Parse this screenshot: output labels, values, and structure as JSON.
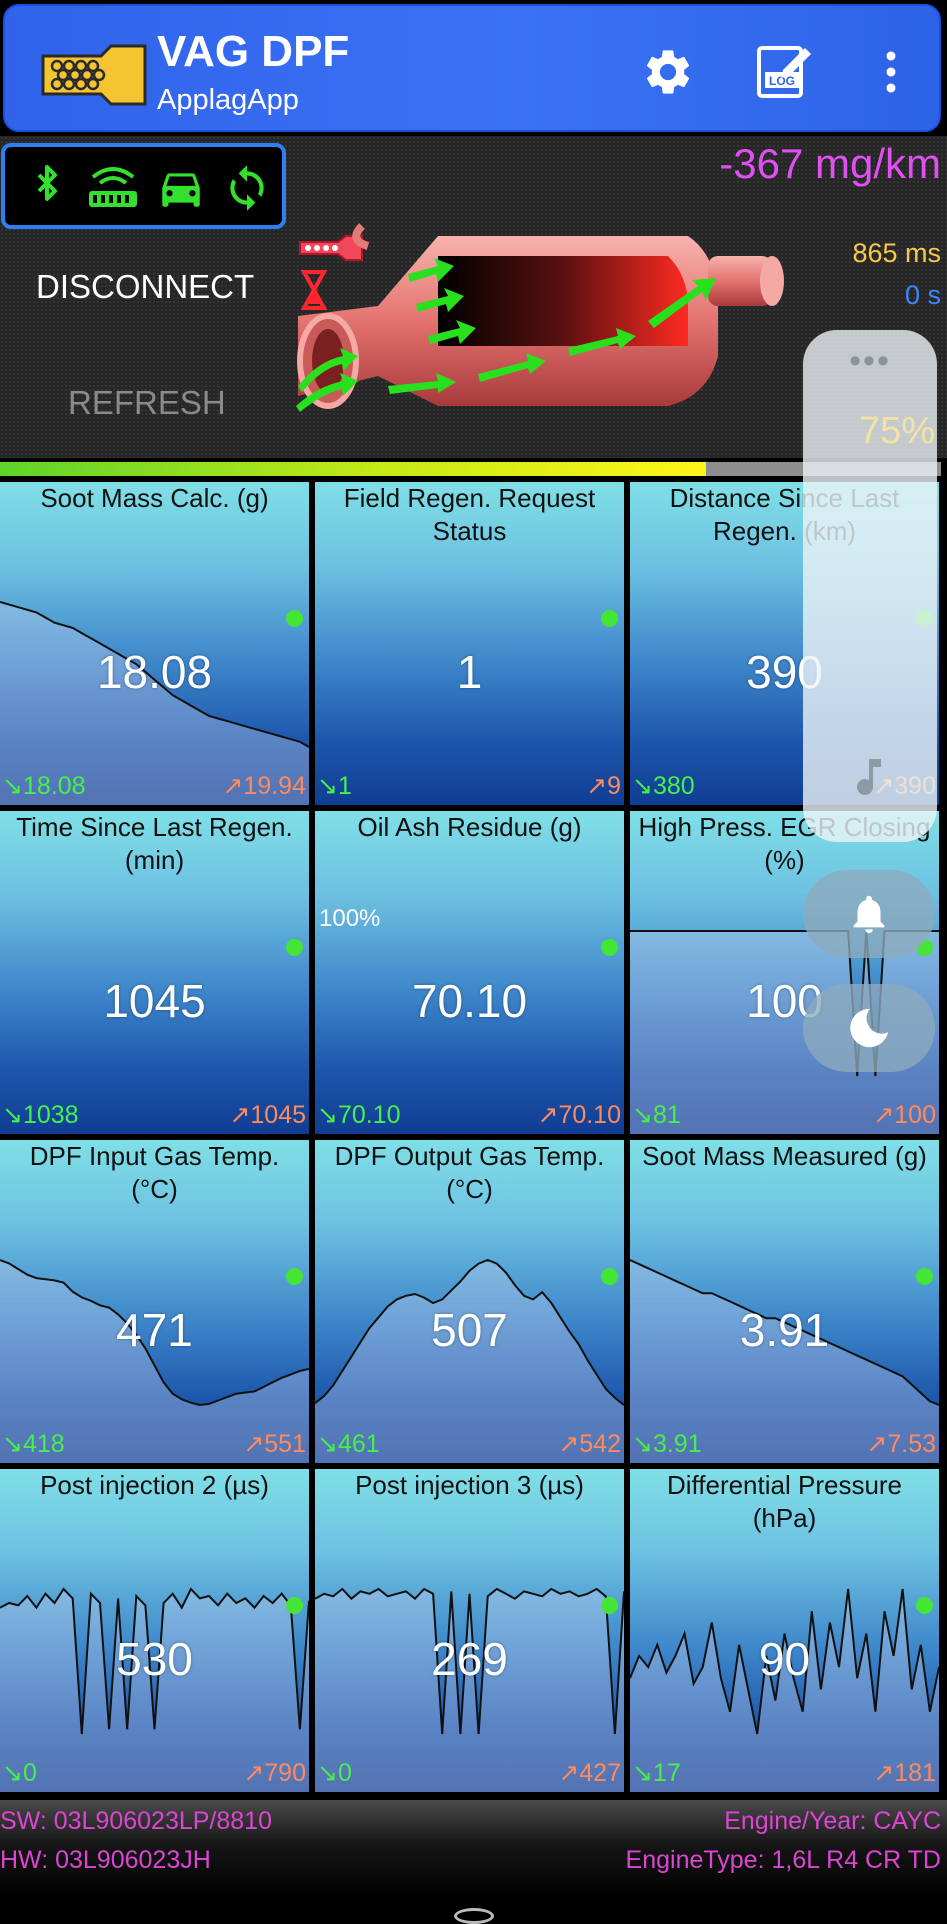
{
  "app": {
    "title": "VAG DPF",
    "subtitle": "ApplagApp",
    "accent": "#2f63ea",
    "actions": [
      {
        "name": "settings",
        "icon": "gear-icon"
      },
      {
        "name": "log",
        "icon": "log-icon"
      },
      {
        "name": "more",
        "icon": "overflow-menu-icon"
      }
    ]
  },
  "header": {
    "connection_icons": [
      "bluetooth-icon",
      "obd-adapter-icon",
      "car-icon",
      "sync-icon"
    ],
    "disconnect_label": "DISCONNECT",
    "refresh_label": "REFRESH",
    "consumption": "-367 mg/km",
    "latency": "865 ms",
    "timer": "0 s",
    "status_icons": [
      "dpf-icon",
      "hourglass-icon"
    ]
  },
  "progress": {
    "value": 0.75
  },
  "tiles": [
    {
      "title": "Soot Mass Calc. (g)",
      "value": "18.08",
      "min": "↘18.08",
      "max": "↗19.94",
      "series": [
        80,
        79,
        78,
        77,
        76,
        74,
        72,
        71,
        70,
        68,
        66,
        64,
        62,
        60,
        58,
        56,
        53,
        50,
        47,
        44,
        42,
        40,
        38,
        36,
        35,
        34,
        33,
        32,
        31,
        30,
        29,
        28,
        27,
        26,
        24
      ]
    },
    {
      "title": "Field Regen. Request Status",
      "value": "1",
      "min": "↘1",
      "max": "↗9"
    },
    {
      "title": "Distance Since Last Regen. (km)",
      "value": "390",
      "min": "↘380",
      "max": "↗390"
    },
    {
      "title": "Time Since Last Regen. (min)",
      "value": "1045",
      "min": "↘1038",
      "max": "↗1045"
    },
    {
      "title": "Oil Ash Residue (g)",
      "value": "70.10",
      "min": "↘70.10",
      "max": "↗70.10",
      "percent": "100%"
    },
    {
      "title": "High Press. EGR Closing (%)",
      "value": "100",
      "min": "↘81",
      "max": "↗100",
      "series": [
        100,
        100,
        100,
        100,
        100,
        100,
        100,
        100,
        100,
        100,
        100,
        100,
        100,
        100,
        100,
        100,
        100,
        100,
        100,
        100,
        100,
        100,
        100,
        100,
        100,
        81,
        100,
        81,
        100,
        100,
        100,
        100,
        100,
        100,
        100
      ]
    },
    {
      "title": "DPF Input Gas Temp. (°C)",
      "value": "471",
      "min": "↘418",
      "max": "↗551",
      "series": [
        548,
        545,
        540,
        535,
        532,
        531,
        530,
        528,
        520,
        515,
        512,
        508,
        506,
        500,
        492,
        482,
        470,
        455,
        440,
        430,
        425,
        422,
        420,
        421,
        424,
        427,
        430,
        431,
        432,
        436,
        440,
        444,
        447,
        450,
        452
      ]
    },
    {
      "title": "DPF Output Gas Temp. (°C)",
      "value": "507",
      "min": "↘461",
      "max": "↗542",
      "series": [
        462,
        466,
        472,
        480,
        488,
        496,
        504,
        510,
        516,
        520,
        522,
        523,
        521,
        518,
        520,
        525,
        530,
        536,
        540,
        542,
        540,
        535,
        528,
        522,
        520,
        524,
        518,
        510,
        502,
        495,
        486,
        478,
        470,
        465,
        461
      ]
    },
    {
      "title": "Soot Mass Measured (g)",
      "value": "3.91",
      "min": "↘3.91",
      "max": "↗7.53",
      "series": [
        7.4,
        7.3,
        7.2,
        7.1,
        7.0,
        6.9,
        6.8,
        6.7,
        6.6,
        6.6,
        6.5,
        6.4,
        6.3,
        6.2,
        6.1,
        6.0,
        6.0,
        5.9,
        5.8,
        5.7,
        5.6,
        5.5,
        5.4,
        5.3,
        5.2,
        5.1,
        5.0,
        4.9,
        4.8,
        4.7,
        4.6,
        4.4,
        4.2,
        4.0,
        3.91
      ]
    },
    {
      "title": "Post injection 2 (µs)",
      "value": "530",
      "min": "↘0",
      "max": "↗790",
      "series": [
        640,
        660,
        650,
        690,
        640,
        700,
        660,
        720,
        680,
        100,
        700,
        660,
        120,
        680,
        120,
        690,
        650,
        120,
        660,
        700,
        640,
        720,
        680,
        690,
        650,
        700,
        660,
        680,
        640,
        690,
        660,
        700,
        650,
        120,
        670
      ]
    },
    {
      "title": "Post injection 3 (µs)",
      "value": "269",
      "min": "↘0",
      "max": "↗427",
      "series": [
        340,
        350,
        345,
        360,
        340,
        355,
        350,
        360,
        345,
        350,
        355,
        340,
        360,
        350,
        60,
        355,
        60,
        350,
        60,
        345,
        360,
        350,
        340,
        355,
        350,
        345,
        360,
        350,
        355,
        345,
        350,
        360,
        345,
        60,
        355
      ]
    },
    {
      "title": "Differential Pressure (hPa)",
      "value": "90",
      "min": "↘17",
      "max": "↗181",
      "series": [
        90,
        110,
        100,
        120,
        95,
        110,
        130,
        85,
        100,
        140,
        90,
        60,
        120,
        80,
        40,
        110,
        70,
        130,
        90,
        60,
        150,
        80,
        140,
        100,
        170,
        90,
        130,
        60,
        150,
        110,
        170,
        80,
        120,
        60,
        100
      ]
    }
  ],
  "footer": {
    "sw": "SW: 03L906023LP/8810",
    "hw": "HW: 03L906023JH",
    "engine_year": "Engine/Year: CAYC",
    "engine_type": "EngineType: 1,6L R4 CR TD"
  },
  "system_overlay": {
    "more_label": "•••",
    "volume": "75%",
    "icons": [
      "music-note-icon",
      "bell-icon",
      "moon-icon"
    ]
  }
}
